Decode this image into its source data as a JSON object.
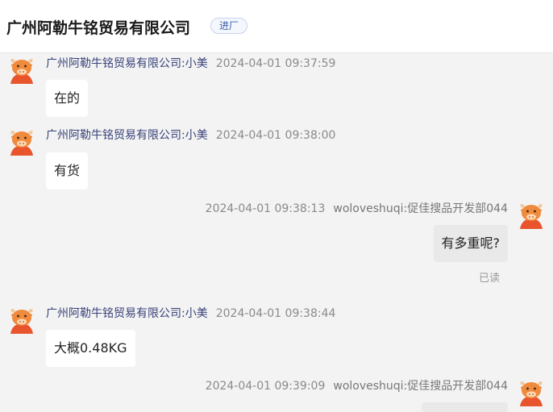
{
  "header": {
    "company_title": "广州阿勒牛铭贸易有限公司",
    "tag": "进厂"
  },
  "messages": [
    {
      "sender": "广州阿勒牛铭贸易有限公司:小美",
      "time": "2024-04-01 09:37:59",
      "text": "在的"
    },
    {
      "sender": "广州阿勒牛铭贸易有限公司:小美",
      "time": "2024-04-01 09:38:00",
      "text": "有货"
    },
    {
      "sender": "woloveshuqi:促佳搜品开发部044",
      "time": "2024-04-01 09:38:13",
      "text": "有多重呢?",
      "status": "已读"
    },
    {
      "sender": "广州阿勒牛铭贸易有限公司:小美",
      "time": "2024-04-01 09:38:44",
      "text": "大概0.48KG"
    },
    {
      "sender": "woloveshuqi:促佳搜品开发部044",
      "time": "2024-04-01 09:39:09",
      "text": ""
    }
  ],
  "colors": {
    "avatar_face": "#f08a3c",
    "avatar_body": "#e8552c",
    "sender_name": "#38427a"
  },
  "icons": {
    "avatar": "cartoon-bull-avatar-icon"
  }
}
